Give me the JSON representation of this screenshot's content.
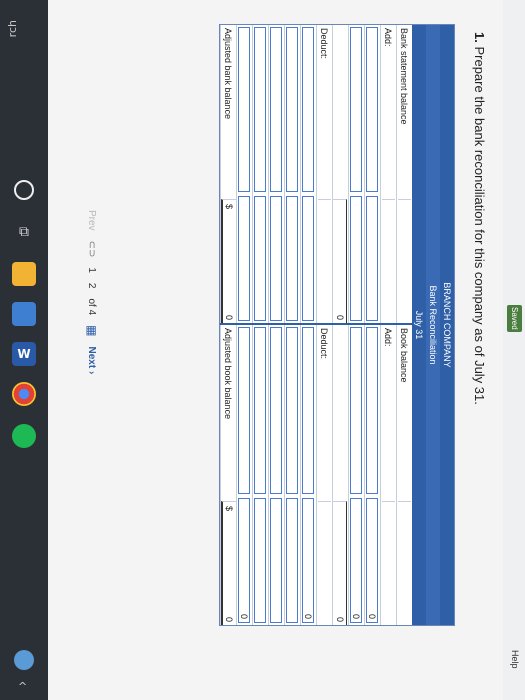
{
  "taskbar": {
    "search_text": "rch",
    "icons": [
      "cortana-circle-icon",
      "task-view-icon",
      "store-icon",
      "app-icon",
      "word-icon",
      "chrome-icon",
      "spotify-icon"
    ]
  },
  "header": {
    "saved": "Saved",
    "help": "Help"
  },
  "question": {
    "number": "1.",
    "text": "Prepare the bank reconciliation for this company as of July 31."
  },
  "recon": {
    "company": "BRANCH COMPANY",
    "title": "Bank Reconciliation",
    "date": "July 31",
    "left": {
      "start_label": "Bank statement balance",
      "add_label": "Add:",
      "subtotal": "0",
      "deduct_label": "Deduct:",
      "final_label": "Adjusted bank balance",
      "final_symbol": "$",
      "final_value": "0"
    },
    "right": {
      "start_label": "Book balance",
      "add_label": "Add:",
      "subtotal": "0",
      "deduct_label": "Deduct:",
      "final_label": "Adjusted book balance",
      "final_symbol": "$",
      "final_value": "0",
      "side_values": [
        "0",
        "0",
        "0",
        "0"
      ]
    }
  },
  "pager": {
    "prev": "Prev",
    "page_a": "1",
    "page_b": "2",
    "of": "of 4",
    "next": "Next"
  }
}
